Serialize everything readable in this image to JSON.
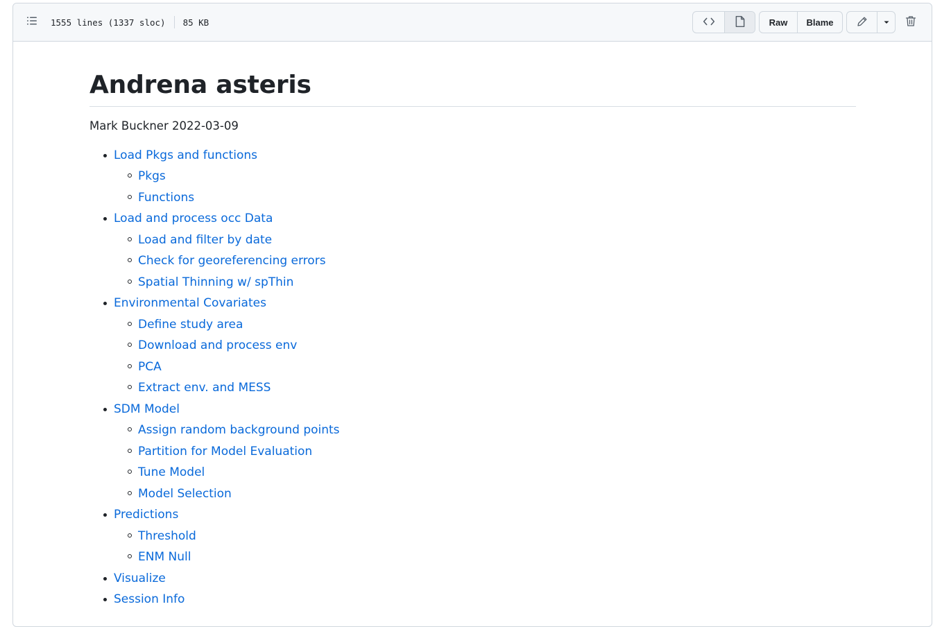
{
  "header": {
    "lines": "1555 lines (1337 sloc)",
    "size": "85 KB",
    "raw_label": "Raw",
    "blame_label": "Blame"
  },
  "doc": {
    "title": "Andrena asteris",
    "author_line": "Mark Buckner 2022-03-09",
    "toc": [
      {
        "label": "Load Pkgs and functions",
        "children": [
          "Pkgs",
          "Functions"
        ]
      },
      {
        "label": "Load and process occ Data",
        "children": [
          "Load and filter by date",
          "Check for georeferencing errors",
          "Spatial Thinning w/ spThin"
        ]
      },
      {
        "label": "Environmental Covariates",
        "children": [
          "Define study area",
          "Download and process env",
          "PCA",
          "Extract env. and MESS"
        ]
      },
      {
        "label": "SDM Model",
        "children": [
          "Assign random background points",
          "Partition for Model Evaluation",
          "Tune Model",
          "Model Selection"
        ]
      },
      {
        "label": "Predictions",
        "children": [
          "Threshold",
          "ENM Null"
        ]
      },
      {
        "label": "Visualize",
        "children": []
      },
      {
        "label": "Session Info",
        "children": []
      }
    ]
  },
  "colors": {
    "link": "#0969da",
    "text": "#1f2328",
    "border": "#d0d7de",
    "header_bg": "#f6f8fa"
  },
  "icons": [
    "list-unordered-icon",
    "code-icon",
    "file-icon",
    "pencil-icon",
    "triangle-down-icon",
    "trash-icon"
  ]
}
